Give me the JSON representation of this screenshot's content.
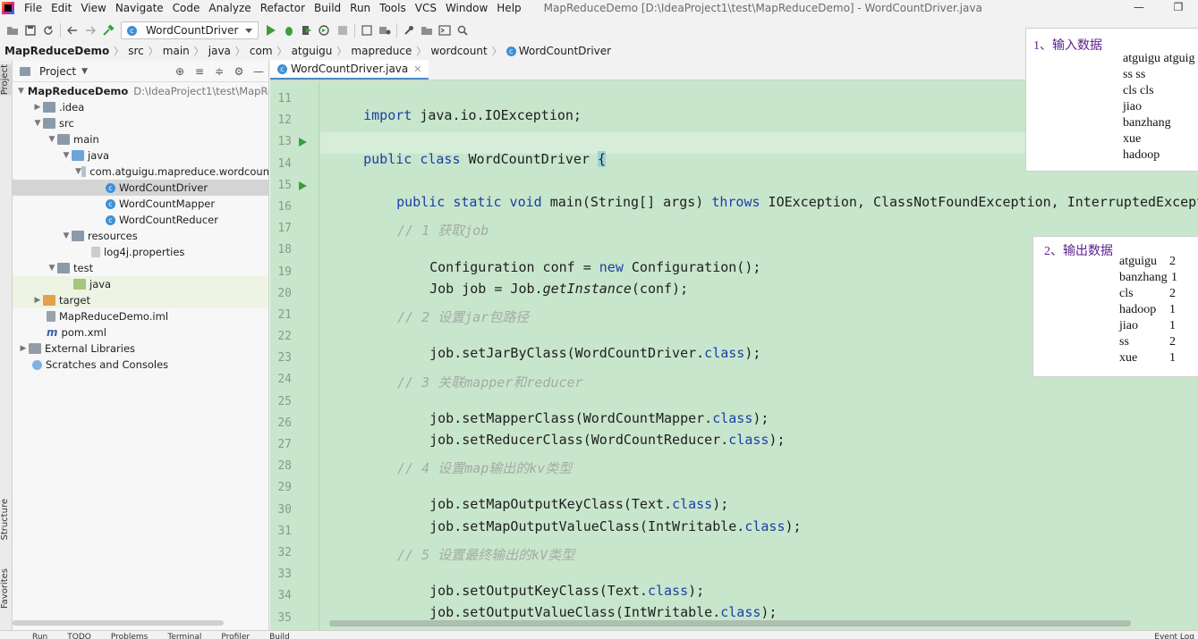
{
  "menubar": {
    "items": [
      "File",
      "Edit",
      "View",
      "Navigate",
      "Code",
      "Analyze",
      "Refactor",
      "Build",
      "Run",
      "Tools",
      "VCS",
      "Window",
      "Help"
    ],
    "window_title": "MapReduceDemo [D:\\IdeaProject1\\test\\MapReduceDemo] - WordCountDriver.java",
    "minimize": "—",
    "maximize": "❐"
  },
  "toolbar": {
    "run_config": "WordCountDriver"
  },
  "breadcrumb": [
    "MapReduceDemo",
    "src",
    "main",
    "java",
    "com",
    "atguigu",
    "mapreduce",
    "wordcount",
    "WordCountDriver"
  ],
  "sidebar": {
    "project_label": "Project",
    "structure_label": "Structure",
    "favorites_label": "Favorites"
  },
  "project_tree": {
    "root": "MapReduceDemo",
    "root_path": "D:\\IdeaProject1\\test\\MapRe",
    "items": [
      "MapReduceDemo",
      ".idea",
      "src",
      "main",
      "java",
      "com.atguigu.mapreduce.wordcoun",
      "WordCountDriver",
      "WordCountMapper",
      "WordCountReducer",
      "resources",
      "log4j.properties",
      "test",
      "java",
      "target",
      "MapReduceDemo.iml",
      "pom.xml",
      "External Libraries",
      "Scratches and Consoles"
    ]
  },
  "editor": {
    "tab_label": "WordCountDriver.java",
    "line_numbers": [
      "11",
      "12",
      "13",
      "14",
      "15",
      "16",
      "17",
      "18",
      "19",
      "20",
      "21",
      "22",
      "23",
      "24",
      "25",
      "26",
      "27",
      "28",
      "29",
      "30",
      "31",
      "32",
      "33",
      "34",
      "35"
    ],
    "code": {
      "l11_kw": "import",
      "l11_rest": " java.io.IOException;",
      "l13_kw": "public class",
      "l13_name": " WordCountDriver ",
      "l13_brace": "{",
      "l15_kw": "public static void",
      "l15_main": " main",
      "l15_args": "(String[] args) ",
      "l15_throws": "throws",
      "l15_ex": " IOException, ClassNotFoundException, InterruptedExcepti",
      "l17": "// 1 获取job",
      "l18_a": "Configuration conf = ",
      "l18_new": "new",
      "l18_b": " Configuration();",
      "l19_a": "Job job = Job.",
      "l19_it": "getInstance",
      "l19_b": "(conf);",
      "l21": "// 2 设置jar包路径",
      "l22_a": "job.setJarByClass(WordCountDriver.",
      "l22_kw": "class",
      "l22_b": ");",
      "l24": "// 3 关联mapper和reducer",
      "l25_a": "job.setMapperClass(WordCountMapper.",
      "l25_kw": "class",
      "l25_b": ");",
      "l26_a": "job.setReducerClass(WordCountReducer.",
      "l26_kw": "class",
      "l26_b": ");",
      "l28": "// 4 设置map输出的kv类型",
      "l29_a": "job.setMapOutputKeyClass(Text.",
      "l29_kw": "class",
      "l29_b": ");",
      "l30_a": "job.setMapOutputValueClass(IntWritable.",
      "l30_kw": "class",
      "l30_b": ");",
      "l32": "// 5 设置最终输出的kV类型",
      "l33_a": "job.setOutputKeyClass(Text.",
      "l33_kw": "class",
      "l33_b": ");",
      "l34_a": "job.setOutputValueClass(IntWritable.",
      "l34_kw": "class",
      "l34_b": ");"
    }
  },
  "input_panel": {
    "title": "1、输入数据",
    "lines": [
      "atguigu atguig",
      "ss ss",
      "cls cls",
      "jiao",
      "banzhang",
      "xue",
      "hadoop"
    ]
  },
  "output_panel": {
    "title": "2、输出数据",
    "rows": [
      {
        "word": "atguigu",
        "count": "2"
      },
      {
        "word": "banzhang",
        "count": "1"
      },
      {
        "word": "cls",
        "count": "2"
      },
      {
        "word": "hadoop",
        "count": "1"
      },
      {
        "word": "jiao",
        "count": "1"
      },
      {
        "word": "ss",
        "count": "2"
      },
      {
        "word": "xue",
        "count": "1"
      }
    ]
  },
  "statusbar": {
    "items": [
      "Run",
      "TODO",
      "Problems",
      "Terminal",
      "Profiler",
      "Build"
    ],
    "event_log": "Event Log"
  },
  "colors": {
    "editor_bg": "#c8e6cc",
    "keyword": "#1b3fa5",
    "comment": "#a4aba5",
    "overlay_title": "#5a1f8a"
  }
}
